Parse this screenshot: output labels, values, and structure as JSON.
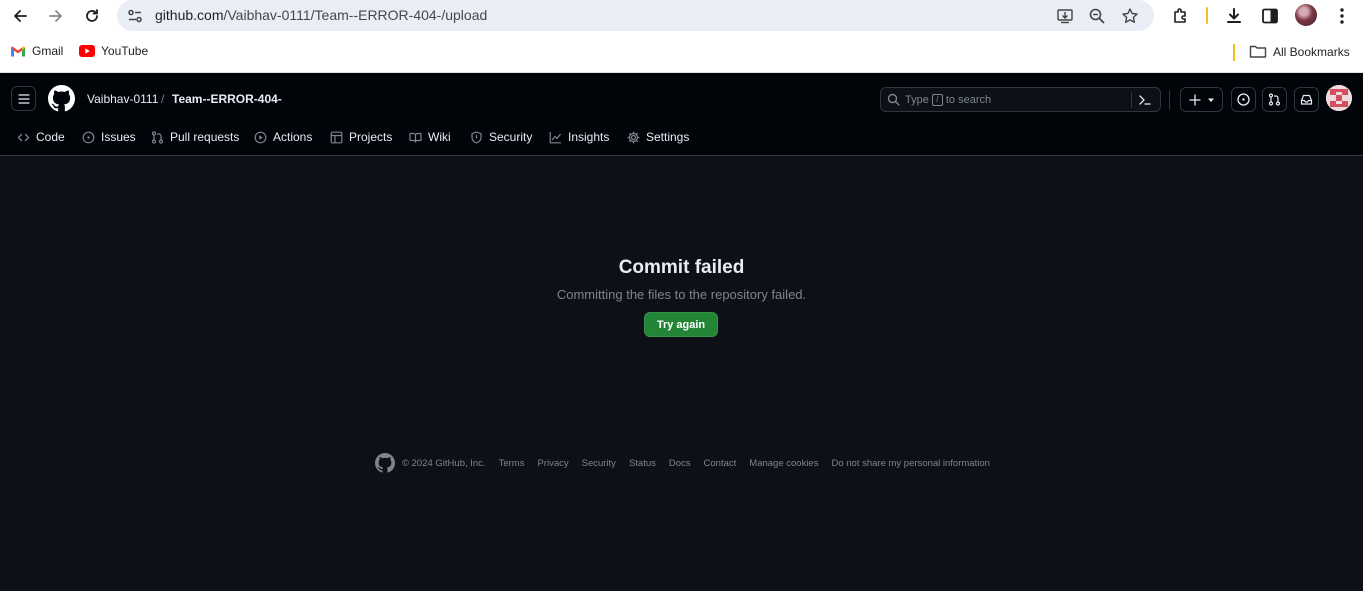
{
  "browser": {
    "url_host": "github.com",
    "url_path": "/Vaibhav-0111/Team--ERROR-404-/upload",
    "bookmarks": [
      {
        "label": "Gmail"
      },
      {
        "label": "YouTube"
      }
    ],
    "all_bookmarks_label": "All Bookmarks"
  },
  "header": {
    "owner": "Vaibhav-0111",
    "separator": "/",
    "repo": "Team--ERROR-404-",
    "search": {
      "prefix": "Type",
      "key": "/",
      "suffix": "to search"
    }
  },
  "repo_nav": {
    "tabs": [
      {
        "label": "Code",
        "icon": "code-icon"
      },
      {
        "label": "Issues",
        "icon": "issue-icon"
      },
      {
        "label": "Pull requests",
        "icon": "pull-request-icon"
      },
      {
        "label": "Actions",
        "icon": "play-icon"
      },
      {
        "label": "Projects",
        "icon": "table-icon"
      },
      {
        "label": "Wiki",
        "icon": "book-icon"
      },
      {
        "label": "Security",
        "icon": "shield-icon"
      },
      {
        "label": "Insights",
        "icon": "graph-icon"
      },
      {
        "label": "Settings",
        "icon": "gear-icon"
      }
    ]
  },
  "main": {
    "title": "Commit failed",
    "message": "Committing the files to the repository failed.",
    "button_label": "Try again"
  },
  "footer": {
    "copyright": "© 2024 GitHub, Inc.",
    "links": [
      "Terms",
      "Privacy",
      "Security",
      "Status",
      "Docs",
      "Contact",
      "Manage cookies",
      "Do not share my personal information"
    ]
  },
  "colors": {
    "page_bg": "#0d1117",
    "header_bg": "#010409",
    "primary_button": "#238636",
    "text": "#e6edf3",
    "muted": "#7d8590"
  }
}
